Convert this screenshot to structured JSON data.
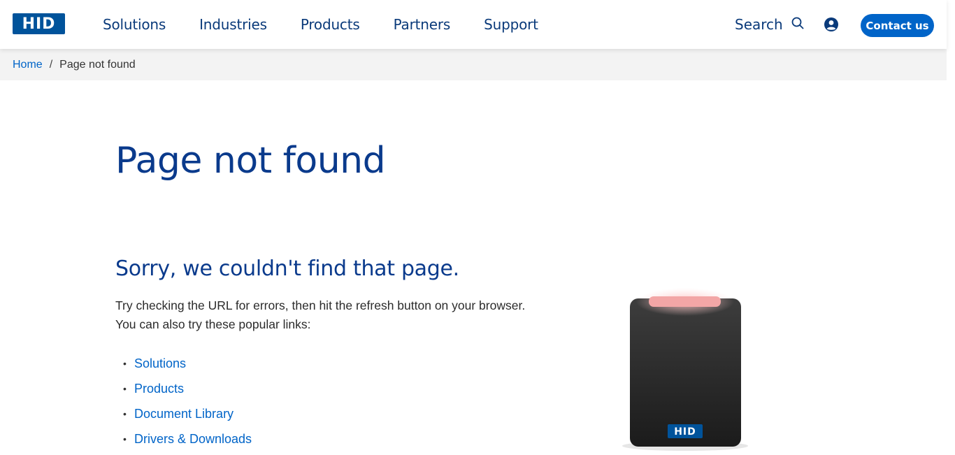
{
  "header": {
    "logo_text": "HID",
    "nav": [
      "Solutions",
      "Industries",
      "Products",
      "Partners",
      "Support"
    ],
    "search_label": "Search",
    "contact_label": "Contact us"
  },
  "breadcrumb": {
    "home": "Home",
    "separator": "/",
    "current": "Page not found"
  },
  "main": {
    "title": "Page not found",
    "subtitle": "Sorry, we couldn't find that page.",
    "desc_line1": "Try checking the URL for errors, then hit the refresh button on your browser.",
    "desc_line2": "You can also try these popular links:",
    "links": [
      "Solutions",
      "Products",
      "Document Library",
      "Drivers & Downloads"
    ]
  },
  "device": {
    "badge_text": "HID"
  },
  "colors": {
    "brand_blue": "#00539b",
    "link_blue": "#0064c8",
    "heading_blue": "#0a3a8c",
    "breadcrumb_bg": "#f3f3f3"
  }
}
